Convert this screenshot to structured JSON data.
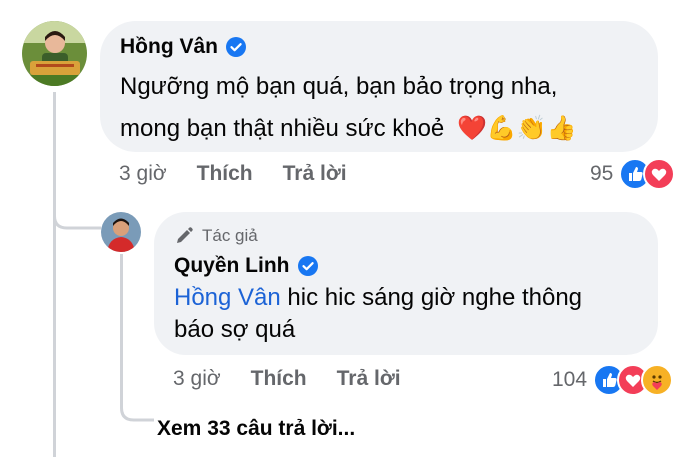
{
  "comment": {
    "author": "Hồng Vân",
    "text_line1": "Ngưỡng mộ bạn quá, bạn bảo trọng nha,",
    "text_line2": "mong bạn thật nhiều sức khoẻ",
    "emojis": "❤️💪👏👍",
    "time": "3 giờ",
    "like_label": "Thích",
    "reply_label": "Trả lời",
    "reaction_count": "95",
    "reaction_icons": [
      "like-icon",
      "love-icon"
    ]
  },
  "reply": {
    "badge": "Tác giả",
    "author": "Quyền Linh",
    "mention": "Hồng Vân",
    "text_rest_line1": " hic hic sáng giờ nghe thông",
    "text_line2": "báo sợ quá",
    "time": "3 giờ",
    "like_label": "Thích",
    "reply_label": "Trả lời",
    "reaction_count": "104",
    "reaction_icons": [
      "like-icon",
      "love-icon",
      "care-icon"
    ]
  },
  "see_more": "Xem 33 câu trả lời...",
  "colors": {
    "bubble_bg": "#f0f2f5",
    "verified_blue": "#1877f2",
    "mention_blue": "#1c63d6",
    "meta_grey": "#65676b",
    "love_red": "#f33e58",
    "like_blue": "#1877f2"
  }
}
